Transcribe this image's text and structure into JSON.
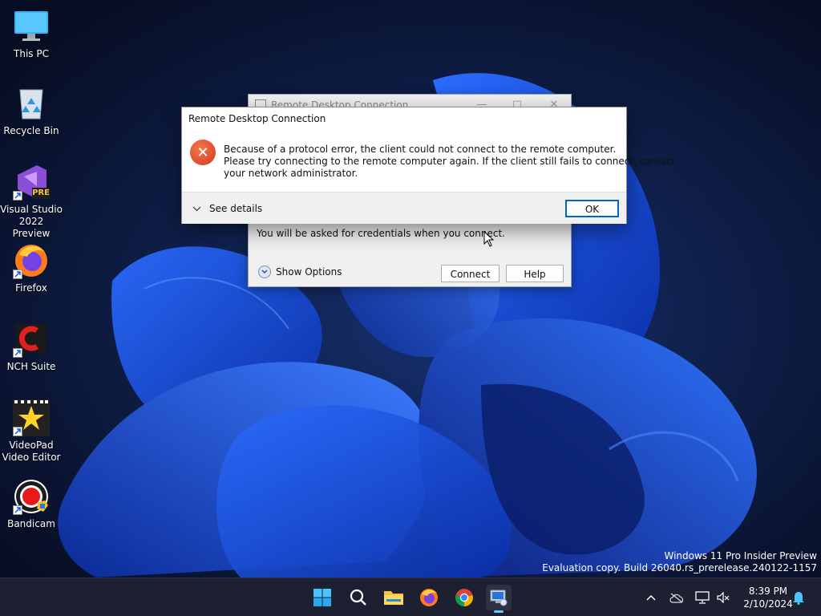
{
  "desktop": {
    "icons": [
      {
        "label": "This PC",
        "icon": "this-pc-icon"
      },
      {
        "label": "Recycle Bin",
        "icon": "recycle-bin-icon"
      },
      {
        "label": "Visual Studio\n2022 Preview",
        "icon": "visual-studio-icon",
        "badge": "PRE"
      },
      {
        "label": "Firefox",
        "icon": "firefox-icon"
      },
      {
        "label": "NCH Suite",
        "icon": "nch-suite-icon"
      },
      {
        "label": "VideoPad\nVideo Editor",
        "icon": "videopad-icon"
      },
      {
        "label": "Bandicam",
        "icon": "bandicam-icon"
      }
    ]
  },
  "rdc_window": {
    "title": "Remote Desktop Connection",
    "credentials_note": "You will be asked for credentials when you connect.",
    "show_options_label": "Show Options",
    "connect_label": "Connect",
    "help_label": "Help"
  },
  "error_dialog": {
    "title": "Remote Desktop Connection",
    "icon": "error-icon",
    "message_lines": [
      "Because of a protocol error, the client could not connect to the remote computer.",
      "Please try connecting to the remote computer again. If the client still fails to connect, contact",
      "your network administrator."
    ],
    "see_details_label": "See details",
    "ok_label": "OK"
  },
  "watermark": {
    "line1": "Windows 11 Pro Insider Preview",
    "line2": "Evaluation copy. Build 26040.rs_prerelease.240122-1157"
  },
  "taskbar": {
    "apps": [
      "start-icon",
      "search-icon",
      "file-explorer-icon",
      "firefox-icon",
      "chrome-icon",
      "remote-desktop-icon"
    ],
    "active_app": "remote-desktop-icon",
    "tray": [
      "chevron-up-icon",
      "onedrive-icon",
      "network-icon",
      "volume-muted-icon"
    ],
    "time": "8:39 PM",
    "date": "2/10/2024",
    "notification_icon": "bell-icon"
  },
  "colors": {
    "accent": "#0067c0",
    "error_red": "#d5361b",
    "taskbar": "#1c2030",
    "wallpaper_blue": "#1a4fd8"
  }
}
